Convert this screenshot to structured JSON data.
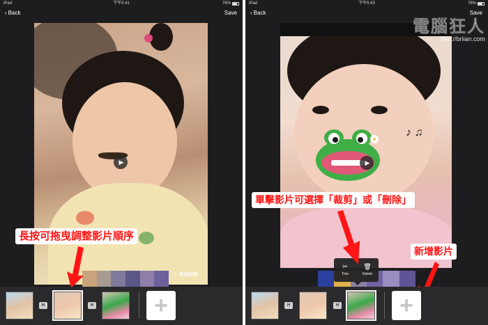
{
  "left_panel": {
    "status": {
      "carrier": "iPad",
      "time": "下午5:41",
      "battery": "76%"
    },
    "nav": {
      "back_label": "Back",
      "save_label": "Save"
    },
    "video": {
      "watermark": "SNOW"
    },
    "callout": "長按可拖曳調整影片順序",
    "timeline": {
      "transition_icon": "H",
      "add_label": "+"
    }
  },
  "right_panel": {
    "status": {
      "carrier": "iPad",
      "time": "下午5:43",
      "battery": "76%"
    },
    "nav": {
      "back_label": "Back",
      "save_label": "Save"
    },
    "site_watermark": {
      "title": "電腦狂人",
      "url": "http://briian.com"
    },
    "callout_select": "單擊影片可選擇「裁剪」或「刪除」",
    "callout_add": "新增影片",
    "popup": {
      "trim_label": "Trim",
      "delete_label": "Delete"
    },
    "timeline": {
      "transition_icon": "H",
      "add_label": "+"
    }
  },
  "colors": {
    "accent_red": "#ff1515",
    "panel_bg": "#1d1d1f",
    "timeline_bg": "#2a2a2c"
  },
  "icons": [
    "chevron-left-icon",
    "play-icon",
    "scissors-icon",
    "trash-icon",
    "plus-icon",
    "transition-icon",
    "battery-icon",
    "wifi-icon"
  ]
}
